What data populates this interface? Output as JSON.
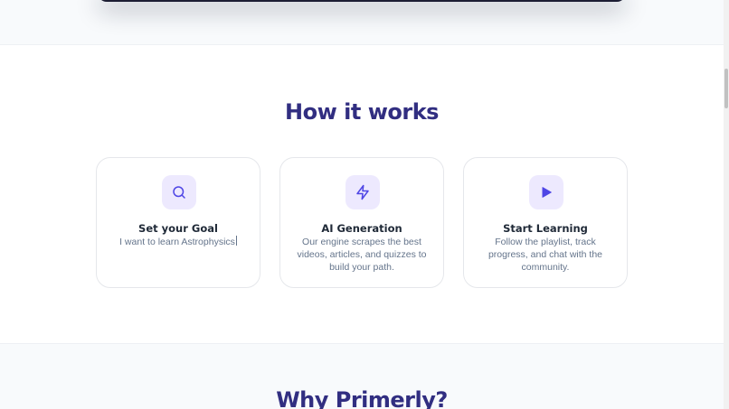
{
  "how_it_works": {
    "title": "How it works",
    "cards": [
      {
        "icon": "search-icon",
        "title": "Set your Goal",
        "text": "I want to learn Astrophysics"
      },
      {
        "icon": "lightning-bolt-icon",
        "title": "AI Generation",
        "text": "Our engine scrapes the best videos, articles, and quizzes to build your path."
      },
      {
        "icon": "play-icon",
        "title": "Start Learning",
        "text": "Follow the playlist, track progress, and chat with the community."
      }
    ]
  },
  "why_section": {
    "title": "Why Primerly?"
  },
  "colors": {
    "heading": "#312e81",
    "icon_accent": "#4f46e5",
    "icon_bg": "#ede9fe",
    "body_text": "#64748b"
  }
}
